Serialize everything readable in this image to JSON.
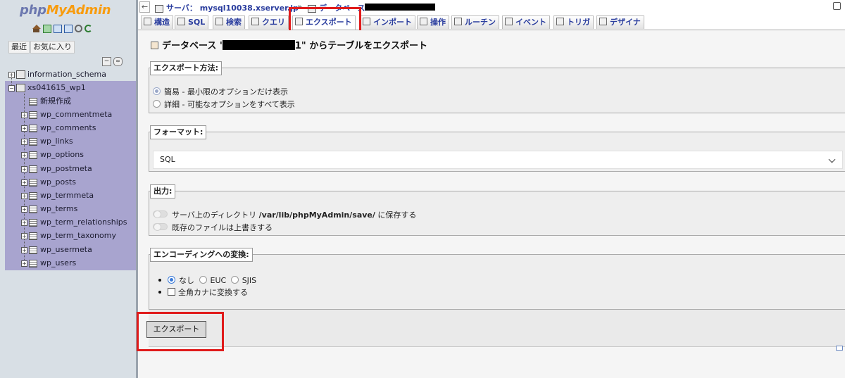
{
  "sidebar": {
    "logo_php": "php",
    "logo_myadmin": "MyAdmin",
    "nav_icons": [
      "home-icon",
      "sql-query-icon",
      "docs-icon",
      "help-icon",
      "settings-icon",
      "reload-icon"
    ],
    "recent_label": "最近",
    "favorites_label": "お気に入り",
    "databases": [
      {
        "name": "information_schema",
        "expanded": false
      },
      {
        "name": "xs041615_wp1",
        "expanded": true,
        "selected": true
      }
    ],
    "new_label": "新規作成",
    "tables": [
      "wp_commentmeta",
      "wp_comments",
      "wp_links",
      "wp_options",
      "wp_postmeta",
      "wp_posts",
      "wp_termmeta",
      "wp_terms",
      "wp_term_relationships",
      "wp_term_taxonomy",
      "wp_usermeta",
      "wp_users"
    ]
  },
  "breadcrumb": {
    "server_label": "サーバ：",
    "server_name": "mysql10038.xserver.jp",
    "separator": "»",
    "database_label": "データベース:"
  },
  "tabs": [
    {
      "label": "構造",
      "icon": "structure-icon"
    },
    {
      "label": "SQL",
      "icon": "sql-icon"
    },
    {
      "label": "検索",
      "icon": "search-icon"
    },
    {
      "label": "クエリ",
      "icon": "query-icon"
    },
    {
      "label": "エクスポート",
      "icon": "export-icon",
      "active": true
    },
    {
      "label": "インポート",
      "icon": "import-icon"
    },
    {
      "label": "操作",
      "icon": "operations-icon"
    },
    {
      "label": "ルーチン",
      "icon": "routines-icon"
    },
    {
      "label": "イベント",
      "icon": "events-icon"
    },
    {
      "label": "トリガ",
      "icon": "triggers-icon"
    },
    {
      "label": "デザイナ",
      "icon": "designer-icon"
    }
  ],
  "main": {
    "title_prefix": "データベース '",
    "title_suffix": "1\" からテーブルをエクスポート",
    "export_method": {
      "legend": "エクスポート方法:",
      "options": [
        {
          "label": "簡易 - 最小限のオプションだけ表示",
          "checked": true
        },
        {
          "label": "詳細 - 可能なオプションをすべて表示",
          "checked": false
        }
      ]
    },
    "format": {
      "legend": "フォーマット:",
      "selected": "SQL"
    },
    "output": {
      "legend": "出力:",
      "save_prefix": "サーバ上のディレクトリ",
      "save_path": "/var/lib/phpMyAdmin/save/",
      "save_suffix": "に保存する",
      "overwrite_label": "既存のファイルは上書きする"
    },
    "encoding": {
      "legend": "エンコーディングへの変換:",
      "options": [
        {
          "label": "なし",
          "checked": true
        },
        {
          "label": "EUC",
          "checked": false
        },
        {
          "label": "SJIS",
          "checked": false
        }
      ],
      "kana_label": "全角カナに変換する"
    },
    "export_button": "エクスポート"
  },
  "colors": {
    "sidebar_bg": "#d8dfe5",
    "selected_db_bg": "#a8a4cf",
    "link_blue": "#2a3d9e",
    "highlight_red": "#e01b1b",
    "fieldset_bg": "#eeeeee"
  }
}
